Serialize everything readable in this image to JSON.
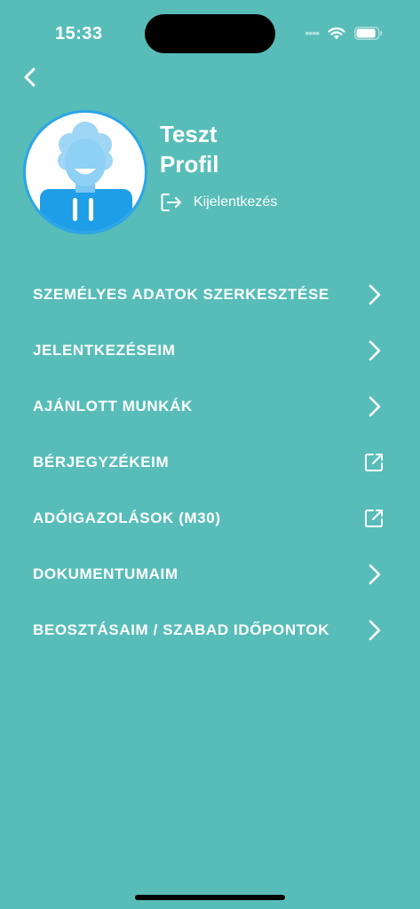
{
  "status_bar": {
    "time": "15:33",
    "battery_level": 0.9
  },
  "profile": {
    "first_line": "Teszt",
    "second_line": "Profil",
    "logout_label": "Kijelentkezés",
    "avatar_colors": {
      "ring": "#2aa5e8",
      "face": "#8fd0f5",
      "shirt": "#1f9ee8"
    }
  },
  "menu": [
    {
      "label": "SZEMÉLYES ADATOK SZERKESZTÉSE",
      "icon": "chevron-right-icon"
    },
    {
      "label": "JELENTKEZÉSEIM",
      "icon": "chevron-right-icon"
    },
    {
      "label": "AJÁNLOTT MUNKÁK",
      "icon": "chevron-right-icon"
    },
    {
      "label": "BÉRJEGYZÉKEIM",
      "icon": "external-link-icon"
    },
    {
      "label": "ADÓIGAZOLÁSOK (M30)",
      "icon": "external-link-icon"
    },
    {
      "label": "DOKUMENTUMAIM",
      "icon": "chevron-right-icon"
    },
    {
      "label": "BEOSZTÁSAIM / SZABAD IDŐPONTOK",
      "icon": "chevron-right-icon"
    }
  ],
  "colors": {
    "background": "#58bdb8",
    "text": "#ffffff"
  }
}
